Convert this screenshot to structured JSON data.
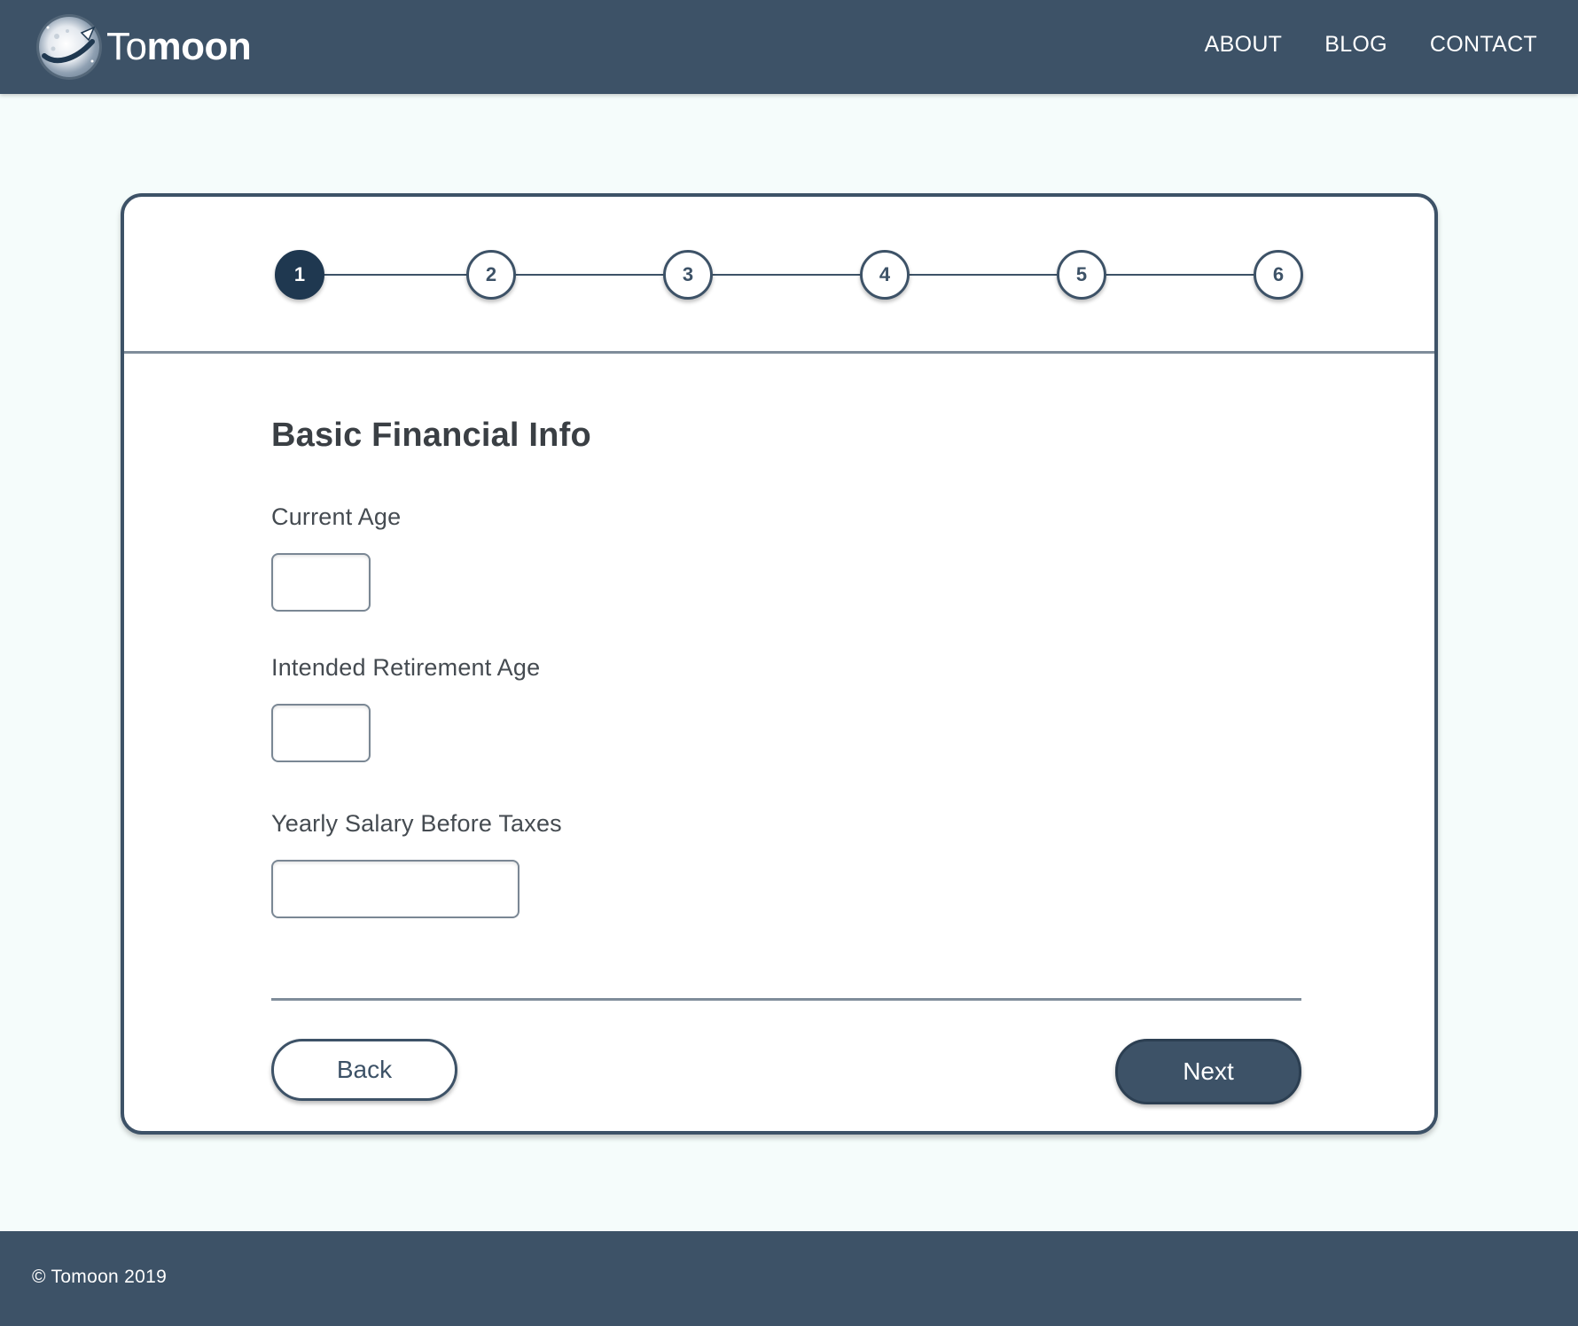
{
  "header": {
    "logo": {
      "icon": "moon-rocket-logo-icon",
      "text_to": "To",
      "text_moon": "moon"
    },
    "nav": [
      {
        "label": "ABOUT"
      },
      {
        "label": "BLOG"
      },
      {
        "label": "CONTACT"
      }
    ]
  },
  "stepper": {
    "steps": [
      "1",
      "2",
      "3",
      "4",
      "5",
      "6"
    ],
    "active_step": 1
  },
  "form": {
    "title": "Basic Financial Info",
    "fields": [
      {
        "label": "Current Age",
        "value": "",
        "placeholder": ""
      },
      {
        "label": "Intended Retirement Age",
        "value": "",
        "placeholder": ""
      },
      {
        "label": "Yearly Salary Before Taxes",
        "value": "",
        "placeholder": ""
      }
    ],
    "back_label": "Back",
    "next_label": "Next"
  },
  "footer": {
    "copyright": "© Tomoon 2019"
  },
  "colors": {
    "header_bg": "#3d5267",
    "page_bg": "#f5fcfb",
    "active_step": "#1f3850",
    "accent": "#3d5267"
  }
}
